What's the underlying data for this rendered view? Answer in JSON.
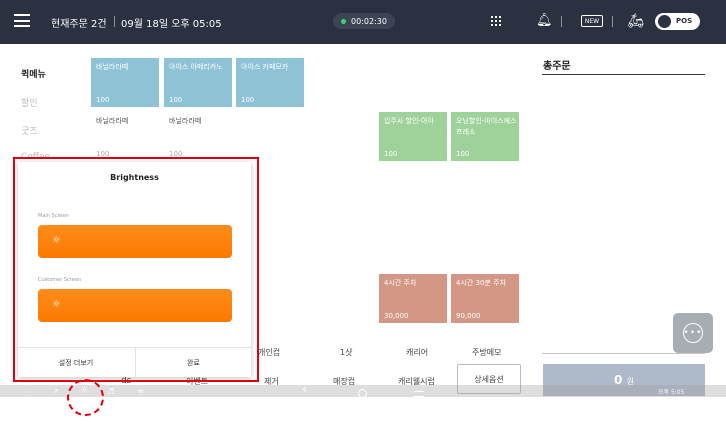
{
  "header": {
    "order_count": "현재주문 2건",
    "datetime": "09월 18일 오후 05:05",
    "timer": "00:02:30",
    "new_badge": "NEW",
    "pos_label": "POS"
  },
  "categories": [
    "퀵메뉴",
    "할인",
    "굿즈",
    "Coffee"
  ],
  "tiles": [
    {
      "name": "바닐라라떼",
      "price": "100",
      "style": "blue"
    },
    {
      "name": "아이스 아메리카노",
      "price": "100",
      "style": "blue"
    },
    {
      "name": "아이스 카페모카",
      "price": "100",
      "style": "blue"
    },
    {
      "name": "바닐라라떼",
      "price": "100",
      "style": "plain"
    },
    {
      "name": "바닐라라떼",
      "price": "100",
      "style": "plain"
    },
    {
      "name": "입주사 할인-아아",
      "price": "100",
      "style": "green"
    },
    {
      "name": "오닝할인-아이스에스프레소",
      "price": "100",
      "style": "green"
    },
    {
      "name": "4시간 주차",
      "price": "30,000",
      "style": "salmon"
    },
    {
      "name": "4시간 30분 주차",
      "price": "90,000",
      "style": "salmon"
    }
  ],
  "order_panel": {
    "title": "총주문",
    "total_amount": "0",
    "currency": "원"
  },
  "function_row_1": [
    "개인컵",
    "1샷",
    "캐리어",
    "주방메모"
  ],
  "function_row_2": {
    "left": "ds",
    "event": "이벤트",
    "remove": "제거",
    "dine_in": "매장컵",
    "carry": "캐리웰시럽",
    "detail": "상세옵션"
  },
  "popup": {
    "title": "Brightness",
    "main_label": "Main Screen",
    "customer_label": "Customer Screen",
    "settings_button": "설정 더보기",
    "done_button": "완료"
  },
  "navbar": {
    "clock": "오후 5:05"
  },
  "colors": {
    "topbar": "#2b3141",
    "accent_orange": "#ff8c1a",
    "annotation_red": "#e2000f"
  }
}
